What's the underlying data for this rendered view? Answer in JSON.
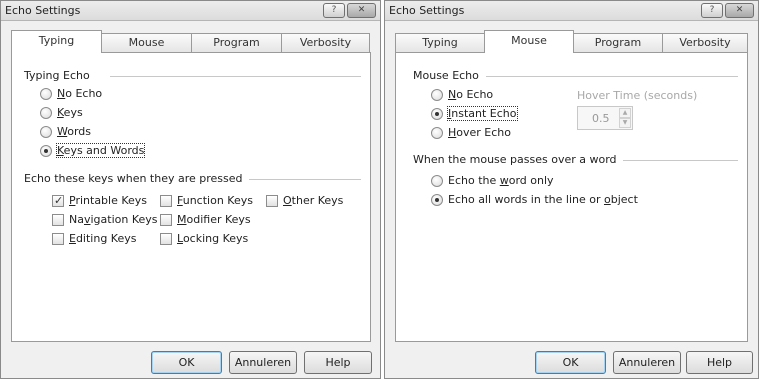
{
  "left_dialog": {
    "title": "Echo Settings",
    "tabs": [
      "Typing",
      "Mouse",
      "Program",
      "Verbosity"
    ],
    "active_tab": "Typing",
    "typing_echo": {
      "label": "Typing Echo",
      "options": {
        "no_echo": {
          "pre": "",
          "key": "N",
          "post": "o Echo"
        },
        "keys": {
          "pre": "",
          "key": "K",
          "post": "eys"
        },
        "words": {
          "pre": "",
          "key": "W",
          "post": "ords"
        },
        "keys_and_words": {
          "pre": "",
          "key": "K",
          "post": "eys and Words"
        }
      },
      "selected": "Keys and Words"
    },
    "echo_keys": {
      "label": "Echo these keys when they are pressed",
      "printable": {
        "pre": "",
        "key": "P",
        "post": "rintable Keys",
        "checked": true
      },
      "function": {
        "pre": "",
        "key": "F",
        "post": "unction Keys",
        "checked": false
      },
      "other": {
        "pre": "",
        "key": "O",
        "post": "ther Keys",
        "checked": false
      },
      "navigation": {
        "pre": "Na",
        "key": "v",
        "post": "igation Keys",
        "checked": false
      },
      "modifier": {
        "pre": "",
        "key": "M",
        "post": "odifier Keys",
        "checked": false
      },
      "editing": {
        "pre": "",
        "key": "E",
        "post": "diting Keys",
        "checked": false
      },
      "locking": {
        "pre": "",
        "key": "L",
        "post": "ocking Keys",
        "checked": false
      }
    },
    "buttons": {
      "ok": "OK",
      "cancel": "Annuleren",
      "help": "Help"
    }
  },
  "right_dialog": {
    "title": "Echo Settings",
    "tabs": [
      "Typing",
      "Mouse",
      "Program",
      "Verbosity"
    ],
    "active_tab": "Mouse",
    "mouse_echo": {
      "label": "Mouse Echo",
      "options": {
        "no_echo": {
          "pre": "",
          "key": "N",
          "post": "o Echo"
        },
        "instant_echo": {
          "pre": "",
          "key": "I",
          "post": "nstant Echo"
        },
        "hover_echo": {
          "pre": "",
          "key": "H",
          "post": "over Echo"
        }
      },
      "selected": "Instant Echo",
      "hover_time_label": "Hover Time (seconds)",
      "hover_time_value": "0.5"
    },
    "word_group": {
      "label": "When the mouse passes over a word",
      "options": {
        "word_only": {
          "pre": "Echo the ",
          "key": "w",
          "post": "ord only"
        },
        "all_words": {
          "pre": "Echo all words in the line or ",
          "key": "o",
          "post": "bject"
        }
      },
      "selected": "Echo all words in the line or object"
    },
    "buttons": {
      "ok": "OK",
      "cancel": "Annuleren",
      "help": "Help"
    }
  },
  "icons": {
    "help": "?",
    "close": "✕",
    "spin_up": "▲",
    "spin_down": "▼"
  }
}
